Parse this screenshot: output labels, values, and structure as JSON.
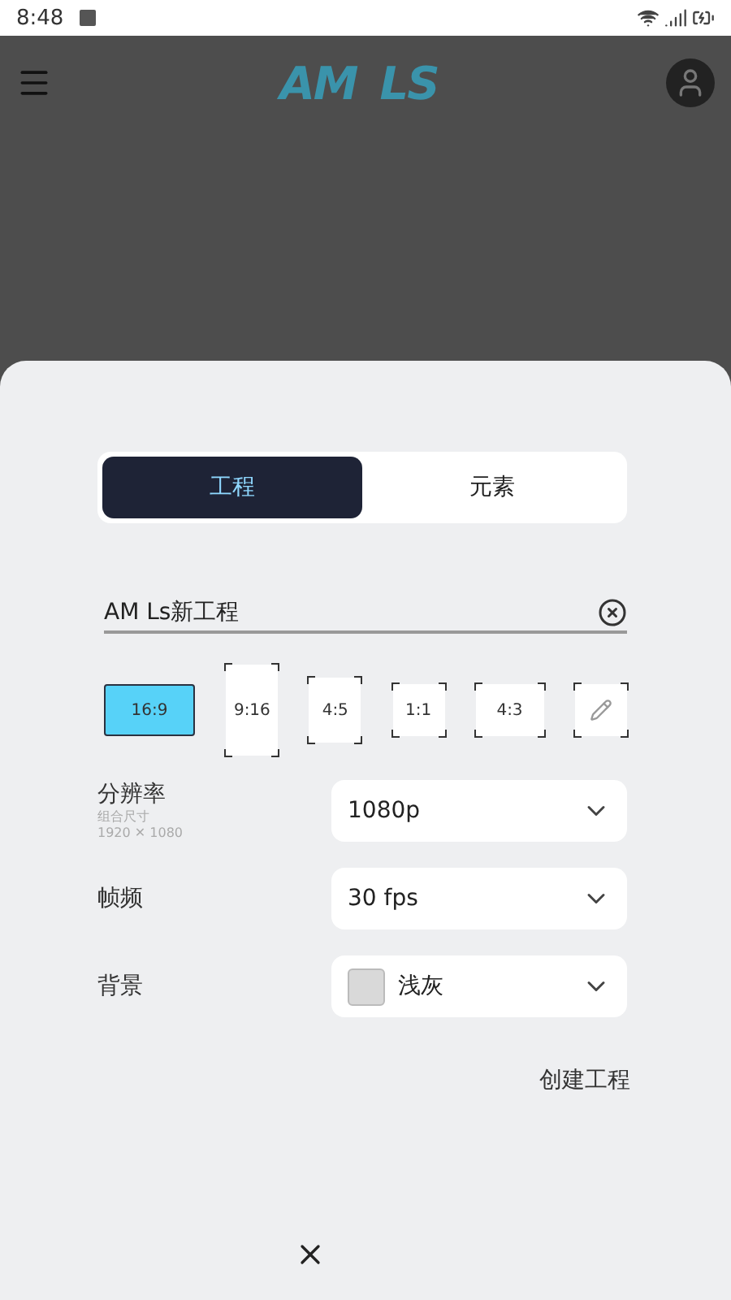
{
  "status_bar": {
    "time": "8:48"
  },
  "app_bar": {
    "logo": [
      "AM",
      "LS"
    ]
  },
  "tabs": [
    {
      "label": "工程",
      "selected": true
    },
    {
      "label": "元素",
      "selected": false
    }
  ],
  "project_name": {
    "value": "AM Ls新工程"
  },
  "aspect_ratios": [
    {
      "kind": "wide",
      "label": "16:9",
      "selected": true
    },
    {
      "kind": "tall",
      "label": "9:16",
      "selected": false
    },
    {
      "kind": "portrait",
      "label": "4:5",
      "selected": false
    },
    {
      "kind": "square",
      "label": "1:1",
      "selected": false
    },
    {
      "kind": "landscape",
      "label": "4:3",
      "selected": false
    },
    {
      "kind": "custom",
      "selected": false
    }
  ],
  "settings": [
    {
      "label": "分辨率",
      "sublabels": [
        "组合尺寸",
        "1920 ✕ 1080"
      ],
      "value": "1080p"
    },
    {
      "label": "帧频",
      "value": "30 fps"
    },
    {
      "label": "背景",
      "value": "浅灰",
      "color": "#d9d9d9"
    }
  ],
  "create_button": "创建工程"
}
